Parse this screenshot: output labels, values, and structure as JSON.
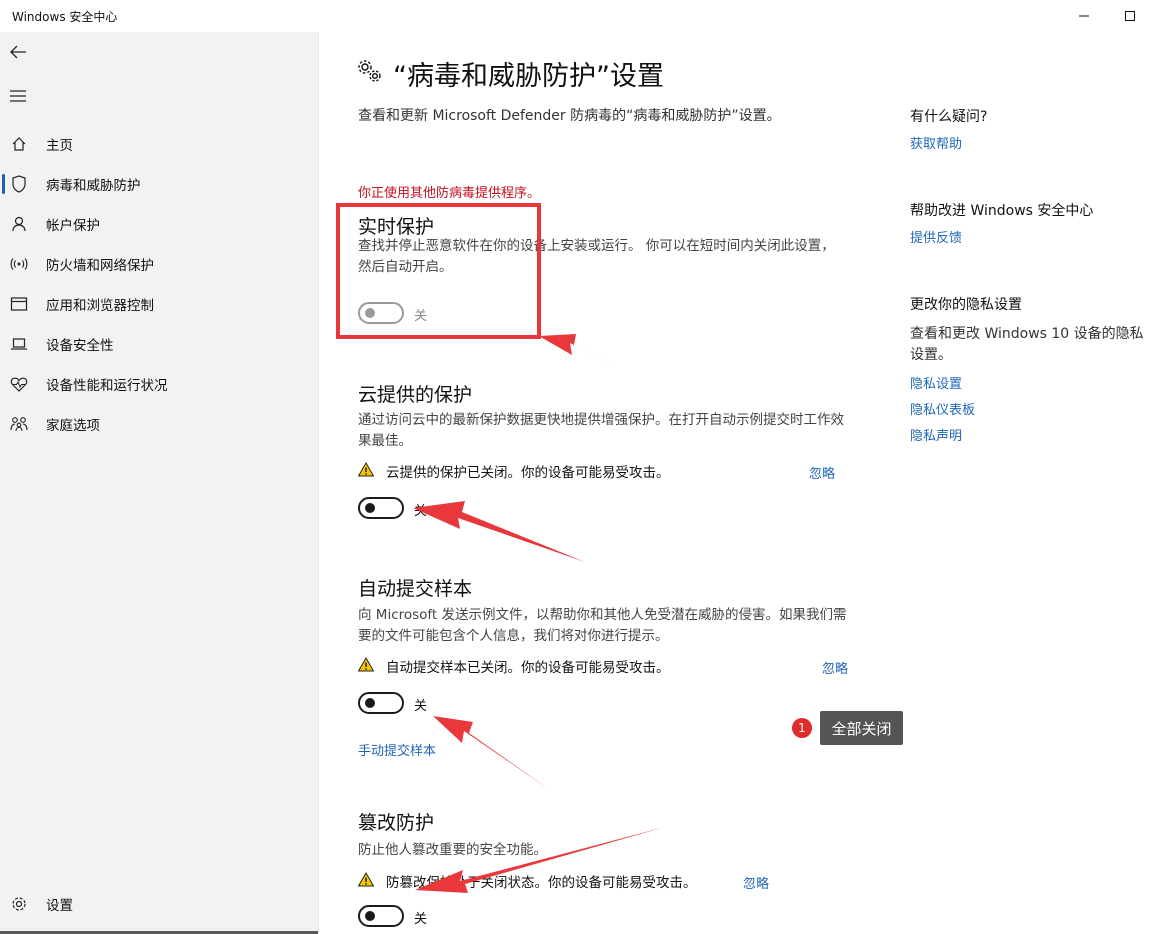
{
  "window": {
    "title": "Windows 安全中心"
  },
  "sidebar": {
    "items": [
      {
        "label": "主页",
        "icon": "home-icon"
      },
      {
        "label": "病毒和威胁防护",
        "icon": "shield-icon",
        "selected": true
      },
      {
        "label": "帐户保护",
        "icon": "person-icon"
      },
      {
        "label": "防火墙和网络保护",
        "icon": "wifi-icon"
      },
      {
        "label": "应用和浏览器控制",
        "icon": "browser-icon"
      },
      {
        "label": "设备安全性",
        "icon": "laptop-icon"
      },
      {
        "label": "设备性能和运行状况",
        "icon": "heart-pulse-icon"
      },
      {
        "label": "家庭选项",
        "icon": "family-icon"
      }
    ],
    "settings_label": "设置"
  },
  "main": {
    "title": "“病毒和威胁防护”设置",
    "description": "查看和更新 Microsoft Defender 防病毒的“病毒和威胁防护”设置。",
    "warning": "你正使用其他防病毒提供程序。",
    "sections": {
      "realtime": {
        "title": "实时保护",
        "body": "查找并停止恶意软件在你的设备上安装或运行。 你可以在短时间内关闭此设置，然后自动开启。",
        "toggle_label": "关",
        "toggle_on": false
      },
      "cloud": {
        "title": "云提供的保护",
        "body": "通过访问云中的最新保护数据更快地提供增强保护。在打开自动示例提交时工作效果最佳。",
        "alert": "云提供的保护已关闭。你的设备可能易受攻击。",
        "ignore": "忽略",
        "toggle_label": "关",
        "toggle_on": false
      },
      "sample": {
        "title": "自动提交样本",
        "body": "向 Microsoft 发送示例文件，以帮助你和其他人免受潜在威胁的侵害。如果我们需要的文件可能包含个人信息，我们将对你进行提示。",
        "alert": "自动提交样本已关闭。你的设备可能易受攻击。",
        "ignore": "忽略",
        "toggle_label": "关",
        "toggle_on": false,
        "manual_link": "手动提交样本"
      },
      "tamper": {
        "title": "篡改防护",
        "body": "防止他人篡改重要的安全功能。",
        "alert": "防篡改保护处于关闭状态。你的设备可能易受攻击。",
        "ignore": "忽略",
        "toggle_label": "关",
        "toggle_on": false
      }
    }
  },
  "aside": {
    "questions_title": "有什么疑问?",
    "get_help": "获取帮助",
    "improve_title": "帮助改进 Windows 安全中心",
    "feedback": "提供反馈",
    "privacy_title": "更改你的隐私设置",
    "privacy_text": "查看和更改 Windows 10 设备的隐私设置。",
    "privacy_links": [
      "隐私设置",
      "隐私仪表板",
      "隐私声明"
    ]
  },
  "annotation": {
    "badge": "1",
    "tooltip": "全部关闭",
    "color": "#e8383c"
  }
}
